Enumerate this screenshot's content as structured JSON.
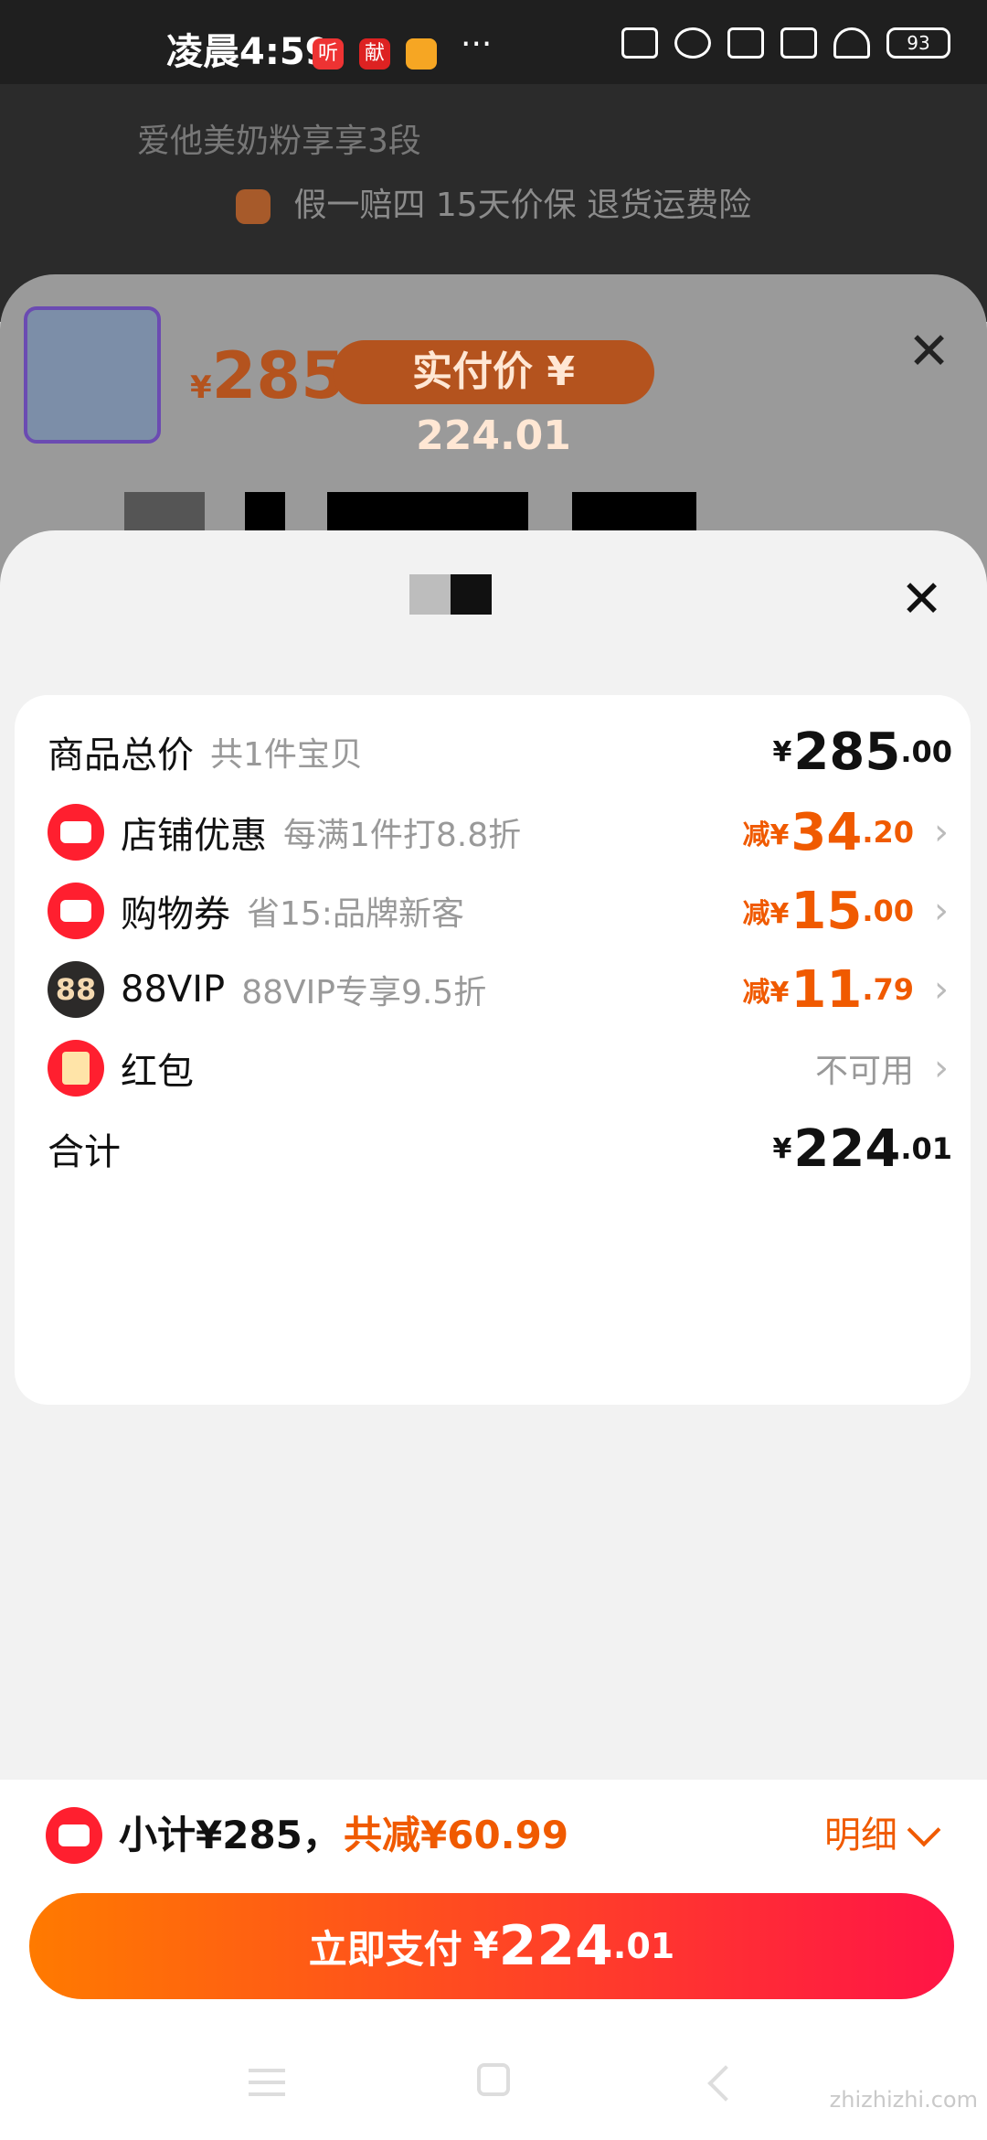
{
  "status_bar": {
    "time": "凌晨4:59",
    "app_icons": [
      "听",
      "献"
    ],
    "more": "···",
    "battery": "93"
  },
  "background": {
    "search_text": "爱他美奶粉享享3段",
    "assurance": "假一赔四 15天价保 退货运费险",
    "price_yen": "¥",
    "price": "285",
    "pay_price_label": "实付价 ¥ 224.01"
  },
  "sheet": {
    "rows": [
      {
        "label": "商品总价",
        "desc": "共1件宝贝",
        "yen": "¥",
        "int": "285",
        "dec": ".00"
      },
      {
        "label": "店铺优惠",
        "desc": "每满1件打8.8折",
        "prefix": "减¥",
        "int": "34",
        "dec": ".20"
      },
      {
        "label": "购物券",
        "desc": "省15:品牌新客",
        "prefix": "减¥",
        "int": "15",
        "dec": ".00"
      },
      {
        "label": "88VIP",
        "desc": "88VIP专享9.5折",
        "prefix": "减¥",
        "int": "11",
        "dec": ".79",
        "icon_text": "88"
      },
      {
        "label": "红包",
        "status": "不可用"
      },
      {
        "label": "合计",
        "yen": "¥",
        "int": "224",
        "dec": ".01"
      }
    ]
  },
  "bottom": {
    "subtotal": "小计¥285，",
    "total_reduce": "共减¥60.99",
    "detail": "明细",
    "pay_label": "立即支付",
    "pay_yen": "¥",
    "pay_int": "224",
    "pay_dec": ".01"
  },
  "watermark": "zhizhizhi.com",
  "colors": {
    "accent": "#f05a00",
    "brand_red": "#ff1f2f"
  }
}
